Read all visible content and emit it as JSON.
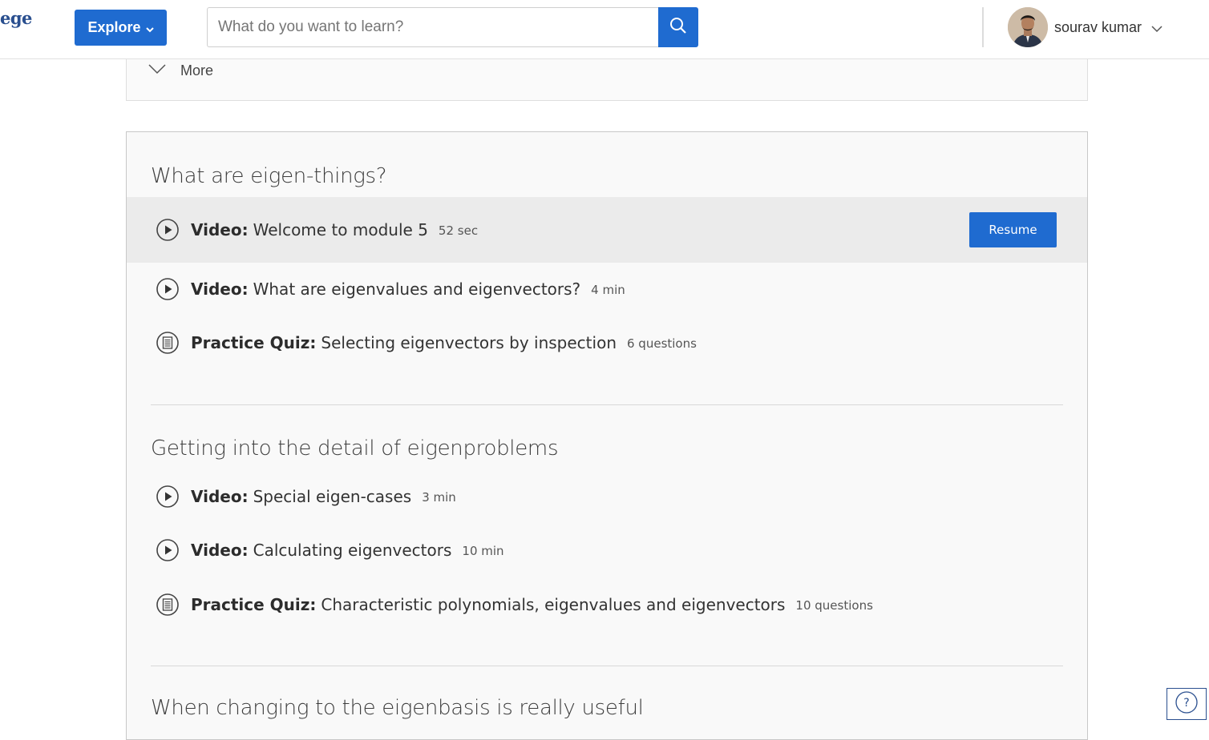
{
  "header": {
    "logo_text": "ege",
    "explore_label": "Explore",
    "search_placeholder": "What do you want to learn?",
    "user_name": "sourav kumar"
  },
  "more_panel": {
    "label": "More"
  },
  "lessons": [
    {
      "title": "What are eigen-things?",
      "items": [
        {
          "type": "Video:",
          "name": "Welcome to module 5",
          "meta": "52 sec",
          "icon": "play-circle-icon",
          "active": true,
          "action": "Resume"
        },
        {
          "type": "Video:",
          "name": "What are eigenvalues and eigenvectors?",
          "meta": "4 min",
          "icon": "play-circle-icon"
        },
        {
          "type": "Practice Quiz:",
          "name": "Selecting eigenvectors by inspection",
          "meta": "6 questions",
          "icon": "quiz-list-icon"
        }
      ]
    },
    {
      "title": "Getting into the detail of eigenproblems",
      "items": [
        {
          "type": "Video:",
          "name": "Special eigen-cases",
          "meta": "3 min",
          "icon": "play-circle-icon"
        },
        {
          "type": "Video:",
          "name": "Calculating eigenvectors",
          "meta": "10 min",
          "icon": "play-circle-icon"
        },
        {
          "type": "Practice Quiz:",
          "name": "Characteristic polynomials, eigenvalues and eigenvectors",
          "meta": "10 questions",
          "icon": "quiz-list-icon"
        }
      ]
    },
    {
      "title": "When changing to the eigenbasis is really useful",
      "items": []
    }
  ],
  "colors": {
    "accent": "#1f6bd0",
    "panel_bg": "#f9f9f9",
    "active_row_bg": "#ebebeb"
  }
}
